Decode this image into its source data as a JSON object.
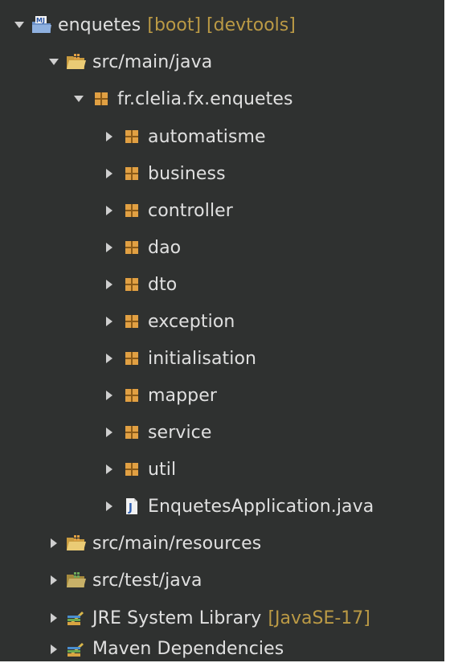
{
  "colors": {
    "background": "#2f3130",
    "text": "#e0e0e0",
    "decoration": "#bb9a45",
    "package_icon": "#e1a043",
    "folder_icon": "#e5c36a"
  },
  "tree": {
    "project": {
      "label": "enquetes",
      "decorations": "[boot] [devtools]",
      "icon": "maven-project-icon",
      "expanded": true
    },
    "source_folder": {
      "label": "src/main/java",
      "icon": "source-folder-icon",
      "expanded": true
    },
    "root_package": {
      "label": "fr.clelia.fx.enquetes",
      "icon": "package-icon",
      "expanded": true
    },
    "packages": [
      {
        "label": "automatisme",
        "icon": "package-icon",
        "expanded": false
      },
      {
        "label": "business",
        "icon": "package-icon",
        "expanded": false
      },
      {
        "label": "controller",
        "icon": "package-icon",
        "expanded": false
      },
      {
        "label": "dao",
        "icon": "package-icon",
        "expanded": false
      },
      {
        "label": "dto",
        "icon": "package-icon",
        "expanded": false
      },
      {
        "label": "exception",
        "icon": "package-icon",
        "expanded": false
      },
      {
        "label": "initialisation",
        "icon": "package-icon",
        "expanded": false
      },
      {
        "label": "mapper",
        "icon": "package-icon",
        "expanded": false
      },
      {
        "label": "service",
        "icon": "package-icon",
        "expanded": false
      },
      {
        "label": "util",
        "icon": "package-icon",
        "expanded": false
      }
    ],
    "java_file": {
      "label": "EnquetesApplication.java",
      "icon": "java-file-icon",
      "expanded": false
    },
    "resources_folder": {
      "label": "src/main/resources",
      "icon": "source-folder-icon",
      "expanded": false
    },
    "test_folder": {
      "label": "src/test/java",
      "icon": "test-source-folder-icon",
      "expanded": false
    },
    "jre_library": {
      "label": "JRE System Library",
      "decorations": "[JavaSE-17]",
      "icon": "library-icon",
      "expanded": false
    },
    "maven_dependencies": {
      "label": "Maven Dependencies",
      "icon": "library-icon",
      "expanded": false
    }
  }
}
